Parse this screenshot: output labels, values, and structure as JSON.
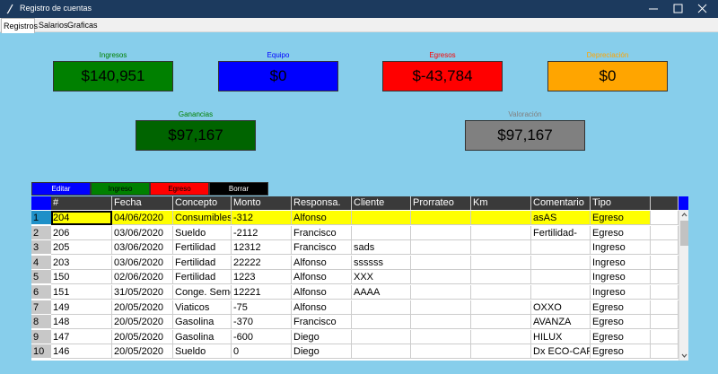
{
  "window": {
    "title": "Registro de cuentas",
    "icon": "feather-icon"
  },
  "tabs": [
    {
      "label": "Registros",
      "active": true
    },
    {
      "label": "Salarios",
      "active": false
    },
    {
      "label": "Graficas",
      "active": false
    }
  ],
  "summary": {
    "ingresos": {
      "label": "Ingresos",
      "value": "$140,951",
      "label_color": "#008000",
      "box_color": "#008000"
    },
    "equipo": {
      "label": "Equipo",
      "value": "$0",
      "label_color": "#0000ff",
      "box_color": "#0000ff"
    },
    "egresos": {
      "label": "Egresos",
      "value": "$-43,784",
      "label_color": "#ff0000",
      "box_color": "#ff0000"
    },
    "depreciacion": {
      "label": "Depreciación",
      "value": "$0",
      "label_color": "#ffa500",
      "box_color": "#ffa500"
    },
    "ganancias": {
      "label": "Ganancias",
      "value": "$97,167",
      "label_color": "#008000",
      "box_color": "#006400"
    },
    "valoracion": {
      "label": "Valoración",
      "value": "$97,167",
      "label_color": "#808080",
      "box_color": "#808080"
    }
  },
  "actions": {
    "editar": {
      "label": "Editar",
      "color": "#0000ff",
      "text_color": "#ffffff"
    },
    "ingreso": {
      "label": "Ingreso",
      "color": "#008000",
      "text_color": "#000000"
    },
    "egreso": {
      "label": "Egreso",
      "color": "#ff0000",
      "text_color": "#000000"
    },
    "borrar": {
      "label": "Borrar",
      "color": "#000000",
      "text_color": "#ffffff"
    }
  },
  "table": {
    "columns": [
      "#",
      "Fecha",
      "Concepto",
      "Monto",
      "Responsa.",
      "Cliente",
      "Prorrateo",
      "Km",
      "Comentario",
      "Tipo"
    ],
    "row_numbers": [
      "1",
      "2",
      "3",
      "4",
      "5",
      "6",
      "7",
      "8",
      "9",
      "10"
    ],
    "rows": [
      [
        "204",
        "04/06/2020",
        "Consumibles",
        "-312",
        "Alfonso",
        "",
        "",
        "",
        "asAS",
        "Egreso"
      ],
      [
        "206",
        "03/06/2020",
        "Sueldo",
        "-2112",
        "Francisco",
        "",
        "",
        "",
        "Fertilidad-",
        "Egreso"
      ],
      [
        "205",
        "03/06/2020",
        "Fertilidad",
        "12312",
        "Francisco",
        "sads",
        "",
        "",
        "",
        "Ingreso"
      ],
      [
        "203",
        "03/06/2020",
        "Fertilidad",
        "22222",
        "Alfonso",
        "ssssss",
        "",
        "",
        "",
        "Ingreso"
      ],
      [
        "150",
        "02/06/2020",
        "Fertilidad",
        "1223",
        "Alfonso",
        "XXX",
        "",
        "",
        "",
        "Ingreso"
      ],
      [
        "151",
        "31/05/2020",
        "Conge. Seme",
        "12221",
        "Alfonso",
        "AAAA",
        "",
        "",
        "",
        "Ingreso"
      ],
      [
        "149",
        "20/05/2020",
        "Viaticos",
        "-75",
        "Alfonso",
        "",
        "",
        "",
        "OXXO",
        "Egreso"
      ],
      [
        "148",
        "20/05/2020",
        "Gasolina",
        "-370",
        "Francisco",
        "",
        "",
        "",
        "AVANZA",
        "Egreso"
      ],
      [
        "147",
        "20/05/2020",
        "Gasolina",
        "-600",
        "Diego",
        "",
        "",
        "",
        "HILUX",
        "Egreso"
      ],
      [
        "146",
        "20/05/2020",
        "Sueldo",
        "0",
        "Diego",
        "",
        "",
        "",
        "Dx ECO-CARI",
        "Egreso"
      ]
    ],
    "highlight_color": "#ffff00"
  }
}
